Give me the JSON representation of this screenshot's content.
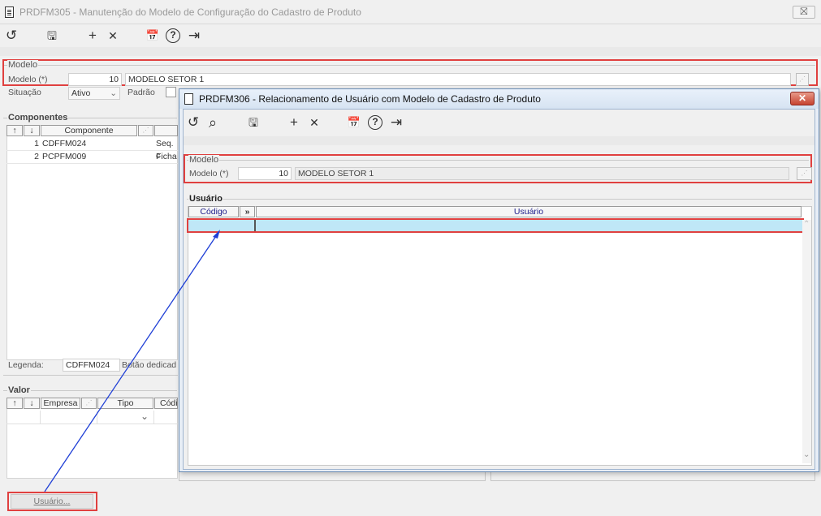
{
  "main_window": {
    "title": "PRDFM305 - Manutenção do Modelo de Configuração do Cadastro de Produto",
    "close_label": "⛝",
    "toolbar": [
      {
        "name": "undo-icon",
        "glyph": "↺"
      },
      {
        "name": "save-icon",
        "glyph": "🖫"
      },
      {
        "name": "add-icon",
        "glyph": "+"
      },
      {
        "name": "delete-icon",
        "glyph": "✕"
      },
      {
        "name": "calendar-icon",
        "glyph": "📅"
      },
      {
        "name": "help-icon",
        "glyph": "?"
      },
      {
        "name": "exit-icon",
        "glyph": "⇥"
      }
    ],
    "modelo_group": {
      "title": "Modelo",
      "modelo_label": "Modelo (*)",
      "modelo_code": "10",
      "modelo_name": "MODELO SETOR 1",
      "situacao_label": "Situação",
      "situacao_value": "Ativo",
      "padrao_label": "Padrão"
    },
    "componentes": {
      "title": "Componentes",
      "col_up": "↑",
      "col_down": "↓",
      "col_componente": "Componente",
      "rows": [
        {
          "seq": "1",
          "componente": "CDFFM024",
          "desc": "Seq. c"
        },
        {
          "seq": "2",
          "componente": "PCPFM009",
          "desc": "Ficha"
        }
      ],
      "legenda_label": "Legenda:",
      "legenda_value": "CDFFM024",
      "legenda_desc": "Botão dedicad"
    },
    "valor": {
      "title": "Valor",
      "col_empresa": "Empresa",
      "col_tipo": "Tipo",
      "col_codigo": "Códi"
    },
    "usuario_button": "Usuário..."
  },
  "dialog": {
    "title": "PRDFM306 - Relacionamento de Usuário com Modelo de Cadastro de Produto",
    "close_label": "✕",
    "toolbar": [
      {
        "name": "undo-icon",
        "glyph": "↺"
      },
      {
        "name": "search-icon",
        "glyph": "⌕"
      },
      {
        "name": "save-icon",
        "glyph": "🖫"
      },
      {
        "name": "add-icon",
        "glyph": "+"
      },
      {
        "name": "delete-icon",
        "glyph": "✕"
      },
      {
        "name": "calendar-icon",
        "glyph": "📅"
      },
      {
        "name": "help-icon",
        "glyph": "?"
      },
      {
        "name": "exit-icon",
        "glyph": "⇥"
      }
    ],
    "modelo_group": {
      "title": "Modelo",
      "modelo_label": "Modelo (*)",
      "modelo_code": "10",
      "modelo_name": "MODELO SETOR 1"
    },
    "usuario_group": {
      "title": "Usuário",
      "col_codigo": "Código",
      "col_sep": "»",
      "col_usuario": "Usuário"
    }
  },
  "colors": {
    "highlight_red": "#e0403f",
    "arrow_blue": "#1f3fd6",
    "selected_row": "#bfe7f7"
  }
}
